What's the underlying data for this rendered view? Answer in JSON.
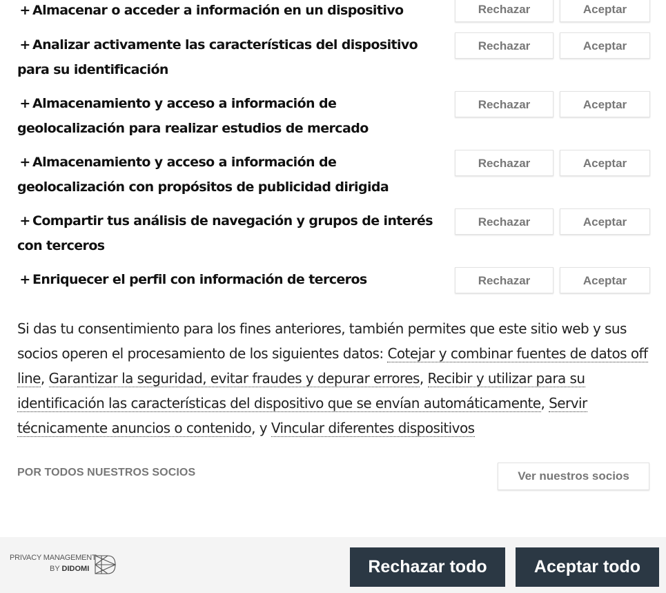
{
  "purposes": [
    {
      "title": "Almacenar o acceder a información en un dispositivo"
    },
    {
      "title": "Analizar activamente las características del dispositivo para su identificación"
    },
    {
      "title": "Almacenamiento y acceso a información de geolocalización para realizar estudios de mercado"
    },
    {
      "title": "Almacenamiento y acceso a información de geolocalización con propósitos de publicidad dirigida"
    },
    {
      "title": "Compartir tus análisis de navegación y grupos de interés con terceros"
    },
    {
      "title": "Enriquecer el perfil con información de terceros"
    }
  ],
  "purpose_prefix": "+",
  "reject_label": "Rechazar",
  "accept_label": "Aceptar",
  "consent": {
    "intro": "Si das tu consentimiento para los fines anteriores, también permites que este sitio web y sus socios operen el procesamiento de los siguientes datos: ",
    "link1": "Cotejar y combinar fuentes de datos off line",
    "sep1": ", ",
    "link2": "Garantizar la seguridad, evitar fraudes y depurar errores",
    "sep2": ", ",
    "link3": "Recibir y utilizar para su identificación las características del dispositivo que se envían automáticamente",
    "sep3": ", ",
    "link4": "Servir técnicamente anuncios o contenido",
    "sep4": ", y ",
    "link5": "Vincular diferentes dispositivos"
  },
  "partners": {
    "label": "POR TODOS NUESTROS SOCIOS",
    "button": "Ver nuestros socios"
  },
  "footer": {
    "brand_line1": "PRIVACY MANAGEMENT",
    "brand_by": "BY ",
    "brand_name": "DIDOMI",
    "reject_all": "Rechazar todo",
    "accept_all": "Aceptar todo"
  },
  "colors": {
    "primary_button": "#2b3844",
    "footer_bg": "#f4f4f4",
    "secondary_text": "#777777"
  }
}
